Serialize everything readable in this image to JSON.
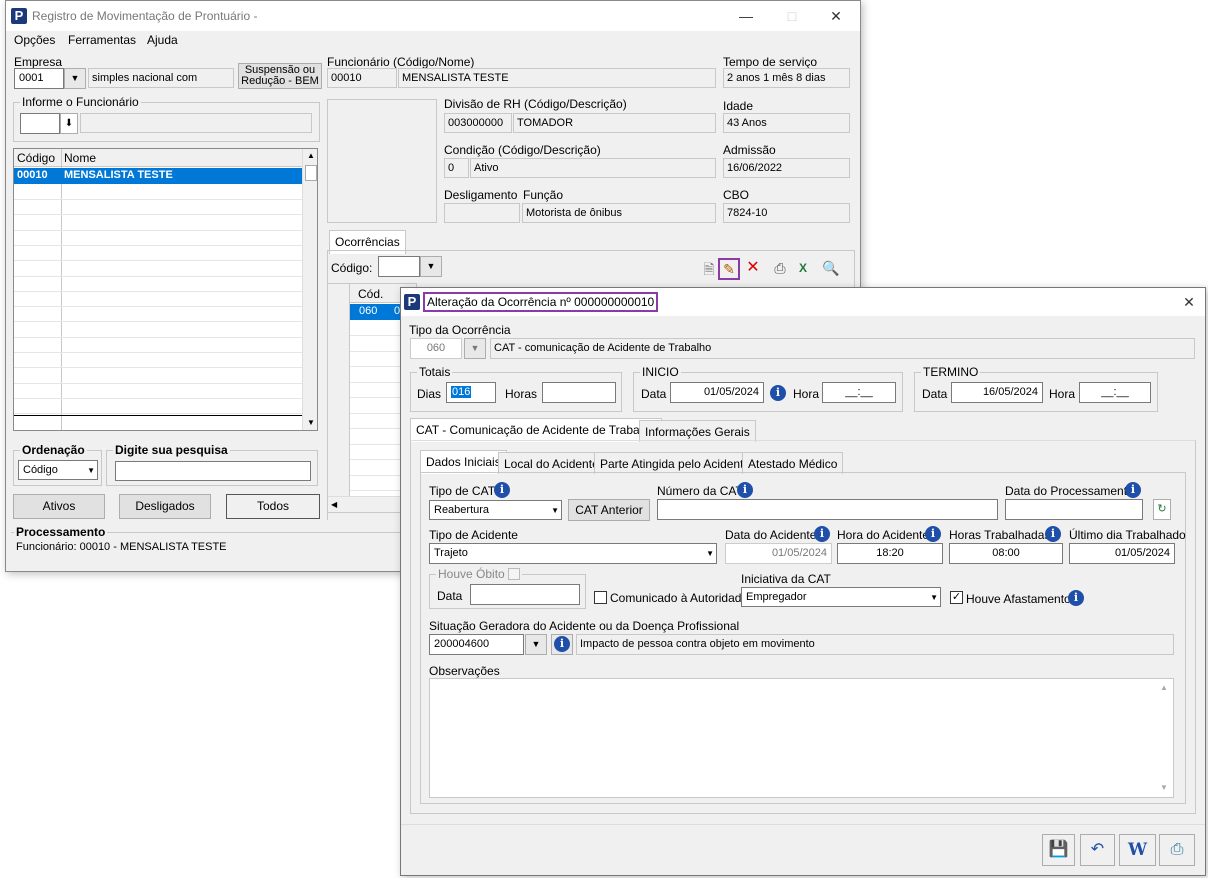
{
  "main": {
    "title": "Registro de Movimentação de Prontuário -",
    "menu": [
      "Opções",
      "Ferramentas",
      "Ajuda"
    ],
    "empresa": {
      "label": "Empresa",
      "code": "0001",
      "name": "simples nacional com"
    },
    "suspensao_btn": {
      "line1": "Suspensão ou",
      "line2": "Redução - BEM"
    },
    "informe_label": "Informe o Funcionário",
    "list": {
      "col_codigo": "Código",
      "col_nome": "Nome",
      "rows": [
        {
          "codigo": "00010",
          "nome": "MENSALISTA TESTE"
        }
      ]
    },
    "ordenacao": {
      "label": "Ordenação",
      "value": "Código"
    },
    "pesquisa_label": "Digite sua pesquisa",
    "buttons": {
      "ativos": "Ativos",
      "desligados": "Desligados",
      "todos": "Todos"
    },
    "processamento": {
      "label": "Processamento",
      "text": "Funcionário: 00010 - MENSALISTA TESTE"
    },
    "funcionario": {
      "label": "Funcionário (Código/Nome)",
      "code": "00010",
      "name": "MENSALISTA TESTE"
    },
    "tempo_servico": {
      "label": "Tempo de serviço",
      "value": "2 anos 1 mês 8 dias"
    },
    "divisao": {
      "label": "Divisão de RH (Código/Descrição)",
      "code": "003000000",
      "desc": "TOMADOR"
    },
    "idade": {
      "label": "Idade",
      "value": "43 Anos"
    },
    "condicao": {
      "label": "Condição (Código/Descrição)",
      "code": "0",
      "desc": "Ativo"
    },
    "admissao": {
      "label": "Admissão",
      "value": "16/06/2022"
    },
    "desligamento": {
      "label": "Desligamento",
      "value": ""
    },
    "funcao": {
      "label": "Função",
      "value": "Motorista de ônibus"
    },
    "cbo": {
      "label": "CBO",
      "value": "7824-10"
    },
    "ocorrencias_tab": "Ocorrências",
    "codigo_label": "Código:",
    "occ_grid": {
      "col_cod": "Cód.",
      "row_cod": "060",
      "row_next": "0"
    }
  },
  "dialog": {
    "title": "Alteração da Ocorrência nº 000000000010",
    "tipo": {
      "label": "Tipo da Ocorrência",
      "code": "060",
      "desc": "CAT - comunicação de Acidente de Trabalho"
    },
    "totais": {
      "label": "Totais",
      "dias_label": "Dias",
      "dias": "016",
      "horas_label": "Horas",
      "horas": ""
    },
    "inicio": {
      "label": "INICIO",
      "data_label": "Data",
      "data": "01/05/2024",
      "hora_label": "Hora",
      "hora": "__:__"
    },
    "termino": {
      "label": "TERMINO",
      "data_label": "Data",
      "data": "16/05/2024",
      "hora_label": "Hora",
      "hora": "__:__"
    },
    "tabs": [
      "CAT - Comunicação de Acidente de Trabalho",
      "Informações Gerais"
    ],
    "subtabs": [
      "Dados Iniciais",
      "Local do Acidente",
      "Parte Atingida pelo Acidente",
      "Atestado Médico"
    ],
    "tipo_cat": {
      "label": "Tipo de CAT",
      "value": "Reabertura"
    },
    "cat_anterior": "CAT Anterior",
    "numero_cat": {
      "label": "Número da CAT",
      "value": ""
    },
    "data_proc": {
      "label": "Data do Processamento",
      "value": ""
    },
    "tipo_acidente": {
      "label": "Tipo de Acidente",
      "value": "Trajeto"
    },
    "data_acidente": {
      "label": "Data do Acidente",
      "value": "01/05/2024"
    },
    "hora_acidente": {
      "label": "Hora do Acidente",
      "value": "18:20"
    },
    "horas_trab": {
      "label": "Horas Trabalhadas",
      "value": "08:00"
    },
    "ultimo_dia": {
      "label": "Último dia Trabalhado",
      "value": "01/05/2024"
    },
    "houve_obito": {
      "label": "Houve Óbito",
      "data_label": "Data",
      "data": ""
    },
    "comunicado": "Comunicado à Autoridade",
    "iniciativa": {
      "label": "Iniciativa da CAT",
      "value": "Empregador"
    },
    "houve_afastamento": "Houve Afastamento",
    "situacao": {
      "label": "Situação Geradora do Acidente ou da Doença Profissional",
      "code": "200004600",
      "desc": "Impacto de pessoa contra objeto em movimento"
    },
    "observacoes": {
      "label": "Observações",
      "value": ""
    }
  }
}
